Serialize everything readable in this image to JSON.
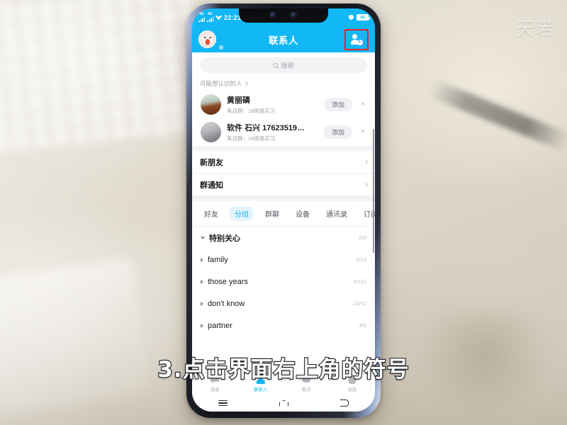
{
  "background": {
    "watermark": "天若"
  },
  "caption": {
    "text": "3.点击界面右上角的符号"
  },
  "phone": {
    "statusbar": {
      "network_label_1": "4G",
      "network_label_2": "4G",
      "clock": "22:21",
      "battery_level": "64"
    },
    "header": {
      "title": "联系人",
      "avatar_icon": "user-avatar",
      "add_contact_icon": "add-person-icon",
      "highlight_color": "#ee2020",
      "accent_color": "#12b7f5"
    },
    "search": {
      "placeholder": "搜索",
      "icon": "search-icon"
    },
    "recommend": {
      "section_title": "可能想认识的人",
      "items": [
        {
          "name": "黄丽磷",
          "subtitle": "来自群：18阅晶实习",
          "action_label": "添加",
          "dismiss_icon": "close-icon"
        },
        {
          "name": "软件 石兴 17623519…",
          "subtitle": "来自群：18阅晶实习",
          "action_label": "添加",
          "dismiss_icon": "close-icon"
        }
      ]
    },
    "menu_items": [
      {
        "label": "新朋友"
      },
      {
        "label": "群通知"
      }
    ],
    "tabs": [
      {
        "label": "好友",
        "active": false
      },
      {
        "label": "分组",
        "active": true
      },
      {
        "label": "群聊",
        "active": false
      },
      {
        "label": "设备",
        "active": false
      },
      {
        "label": "通讯录",
        "active": false
      },
      {
        "label": "订阅",
        "active": false
      }
    ],
    "groups": [
      {
        "name": "特别关心",
        "count": "0/0",
        "expanded": true
      },
      {
        "name": "family",
        "count": "6/13",
        "expanded": false
      },
      {
        "name": "those years",
        "count": "20/31",
        "expanded": false
      },
      {
        "name": "don't know",
        "count": "23/51",
        "expanded": false
      },
      {
        "name": "partner",
        "count": "4/9",
        "expanded": false
      }
    ],
    "bottom_nav": [
      {
        "label": "消息",
        "icon": "message-icon",
        "active": false
      },
      {
        "label": "联系人",
        "icon": "contacts-icon",
        "active": true
      },
      {
        "label": "看点",
        "icon": "discover-icon",
        "active": false
      },
      {
        "label": "动态",
        "icon": "moments-icon",
        "active": false
      }
    ],
    "system_nav": [
      {
        "icon": "menu-icon"
      },
      {
        "icon": "home-icon"
      },
      {
        "icon": "back-icon"
      }
    ]
  }
}
